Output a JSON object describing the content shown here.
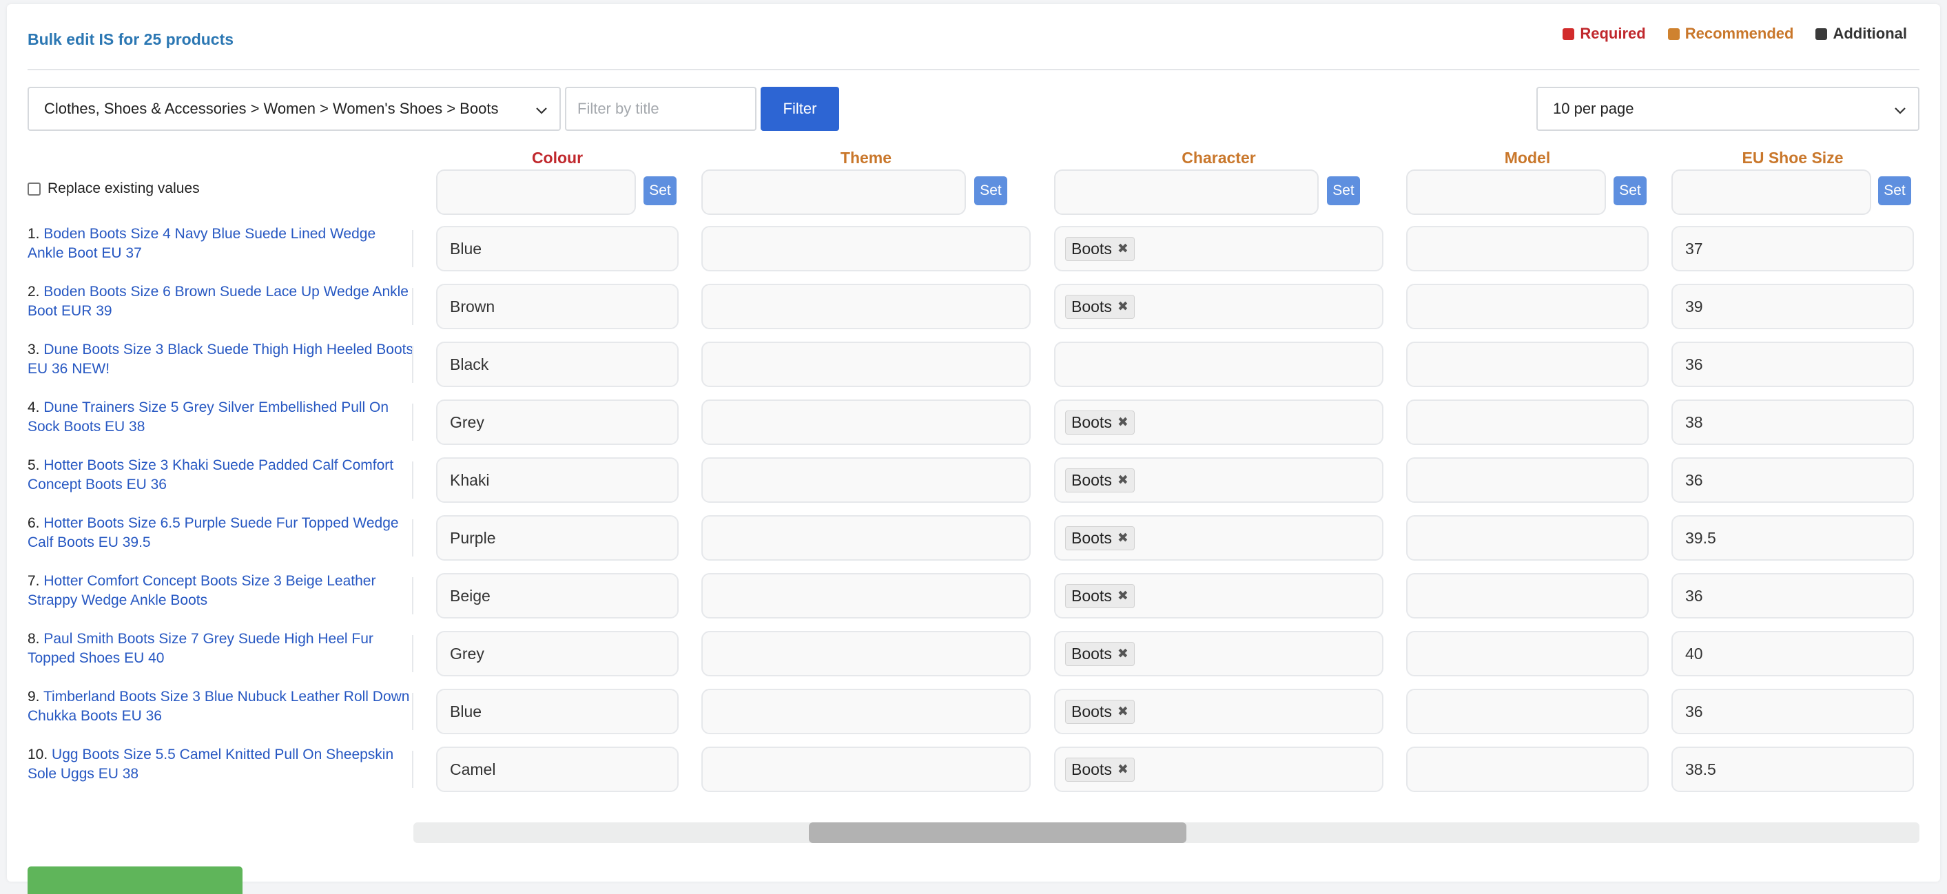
{
  "title": "Bulk edit IS for 25 products",
  "legend": [
    {
      "label": "Required",
      "color": "#d22b2b"
    },
    {
      "label": "Recommended",
      "color": "#cf822f"
    },
    {
      "label": "Additional",
      "color": "#3a3a3a"
    }
  ],
  "category_select": {
    "value": "Clothes, Shoes & Accessories > Women > Women's Shoes > Boots"
  },
  "filter": {
    "placeholder": "Filter by title",
    "button_label": "Filter"
  },
  "per_page": {
    "value": "10 per page"
  },
  "replace_label": "Replace existing values",
  "set_label": "Set",
  "columns": [
    {
      "label": "Colour",
      "kind": "required",
      "color": "#c0282d"
    },
    {
      "label": "Theme",
      "kind": "recommended",
      "color": "#c9772b"
    },
    {
      "label": "Character",
      "kind": "recommended",
      "color": "#c9772b"
    },
    {
      "label": "Model",
      "kind": "recommended",
      "color": "#c9772b"
    },
    {
      "label": "EU Shoe Size",
      "kind": "recommended",
      "color": "#c9772b"
    }
  ],
  "rows": [
    {
      "num": "1.",
      "title": "Boden Boots Size 4 Navy Blue Suede Lined Wedge Ankle Boot EU 37",
      "colour": "Blue",
      "theme": "",
      "character": "Boots",
      "model": "",
      "size": "37"
    },
    {
      "num": "2.",
      "title": "Boden Boots Size 6 Brown Suede Lace Up Wedge Ankle Boot EUR 39",
      "colour": "Brown",
      "theme": "",
      "character": "Boots",
      "model": "",
      "size": "39"
    },
    {
      "num": "3.",
      "title": "Dune Boots Size 3 Black Suede Thigh High Heeled Boots EU 36 NEW!",
      "colour": "Black",
      "theme": "",
      "character": "",
      "model": "",
      "size": "36"
    },
    {
      "num": "4.",
      "title": "Dune Trainers Size 5 Grey Silver Embellished Pull On Sock Boots EU 38",
      "colour": "Grey",
      "theme": "",
      "character": "Boots",
      "model": "",
      "size": "38"
    },
    {
      "num": "5.",
      "title": "Hotter Boots Size 3 Khaki Suede Padded Calf Comfort Concept Boots EU 36",
      "colour": "Khaki",
      "theme": "",
      "character": "Boots",
      "model": "",
      "size": "36"
    },
    {
      "num": "6.",
      "title": "Hotter Boots Size 6.5 Purple Suede Fur Topped Wedge Calf Boots EU 39.5",
      "colour": "Purple",
      "theme": "",
      "character": "Boots",
      "model": "",
      "size": "39.5"
    },
    {
      "num": "7.",
      "title": "Hotter Comfort Concept Boots Size 3 Beige Leather Strappy Wedge Ankle Boots",
      "colour": "Beige",
      "theme": "",
      "character": "Boots",
      "model": "",
      "size": "36"
    },
    {
      "num": "8.",
      "title": "Paul Smith Boots Size 7 Grey Suede High Heel Fur Topped Shoes EU 40",
      "colour": "Grey",
      "theme": "",
      "character": "Boots",
      "model": "",
      "size": "40"
    },
    {
      "num": "9.",
      "title": "Timberland Boots Size 3 Blue Nubuck Leather Roll Down Chukka Boots EU 36",
      "colour": "Blue",
      "theme": "",
      "character": "Boots",
      "model": "",
      "size": "36"
    },
    {
      "num": "10.",
      "title": "Ugg Boots Size 5.5 Camel Knitted Pull On Sheepskin Sole Uggs EU 38",
      "colour": "Camel",
      "theme": "",
      "character": "Boots",
      "model": "",
      "size": "38.5"
    }
  ],
  "icons": {
    "select_arrow": "chevron-down-icon",
    "tag_remove": "close-icon"
  }
}
